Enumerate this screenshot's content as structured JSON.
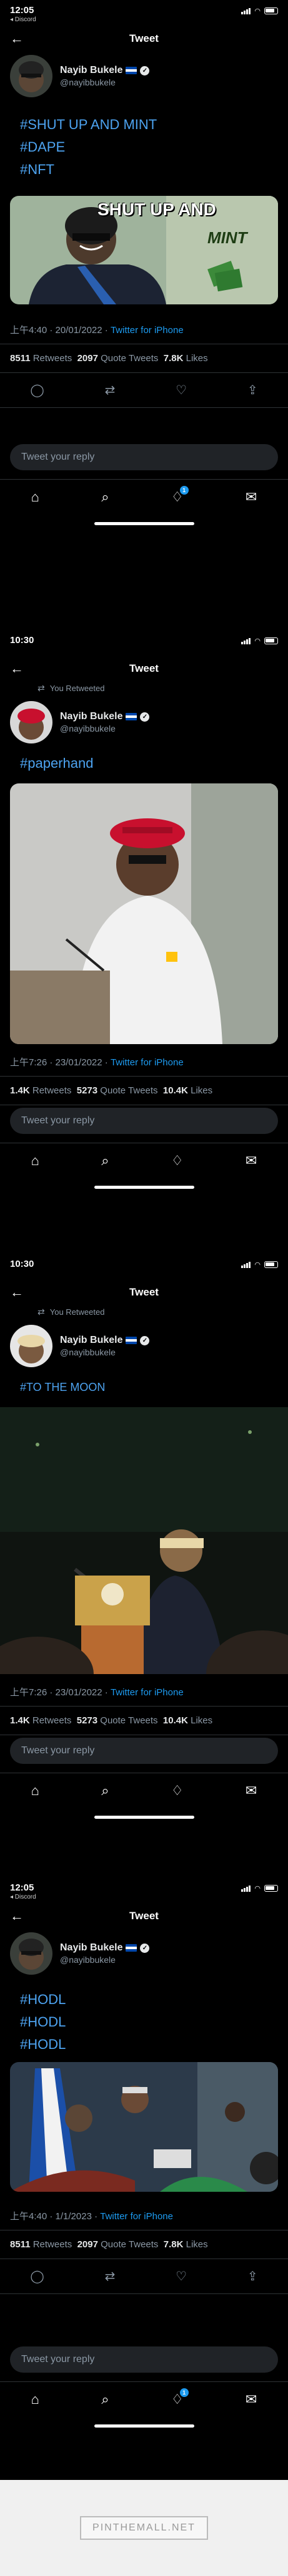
{
  "common": {
    "nav_title": "Tweet",
    "author_name": "Nayib Bukele",
    "author_handle": "@nayibbukele",
    "reply_placeholder": "Tweet your reply",
    "retweets_label": "Retweets",
    "quote_label": "Quote Tweets",
    "likes_label": "Likes",
    "back_app": "◂ Discord",
    "you_retweeted": "You Retweeted",
    "badge": "1",
    "via": "Twitter for iPhone",
    "watermark": "PINTHEMALL.NET"
  },
  "colors": {
    "link": "#1d9bf0",
    "hashtag": "#4da3f0",
    "muted": "#8b98a5",
    "background": "#000000"
  },
  "icons": [
    "back-arrow-icon",
    "retweet-icon",
    "verified-icon",
    "reply-icon",
    "like-icon",
    "share-icon",
    "home-icon",
    "search-icon",
    "bell-icon",
    "mail-icon",
    "signal-icon",
    "wifi-icon",
    "battery-icon"
  ],
  "tweets": [
    {
      "time": "12:05",
      "retweeted": false,
      "lines": [
        "#SHUT UP AND MINT",
        "#DAPE",
        "#NFT"
      ],
      "media_caption_1": "SHUT UP AND",
      "media_caption_2": "MINT",
      "timestamp": "上午4:40 · 20/01/2022 · ",
      "retweets": "8511",
      "quotes": "2097",
      "likes": "7.8K"
    },
    {
      "time": "10:30",
      "retweeted": true,
      "lines": [
        "#paperhand"
      ],
      "timestamp": "上午7:26 · 23/01/2022 · ",
      "retweets": "1.4K",
      "quotes": "5273",
      "likes": "10.4K"
    },
    {
      "time": "10:30",
      "retweeted": true,
      "lines": [
        "#TO THE MOON"
      ],
      "timestamp": "上午7:26 · 23/01/2022 · ",
      "retweets": "1.4K",
      "quotes": "5273",
      "likes": "10.4K"
    },
    {
      "time": "12:05",
      "retweeted": false,
      "lines": [
        "#HODL",
        "#HODL",
        "#HODL"
      ],
      "timestamp": "上午4:40 · 1/1/2023 · ",
      "retweets": "8511",
      "quotes": "2097",
      "likes": "7.8K"
    }
  ]
}
